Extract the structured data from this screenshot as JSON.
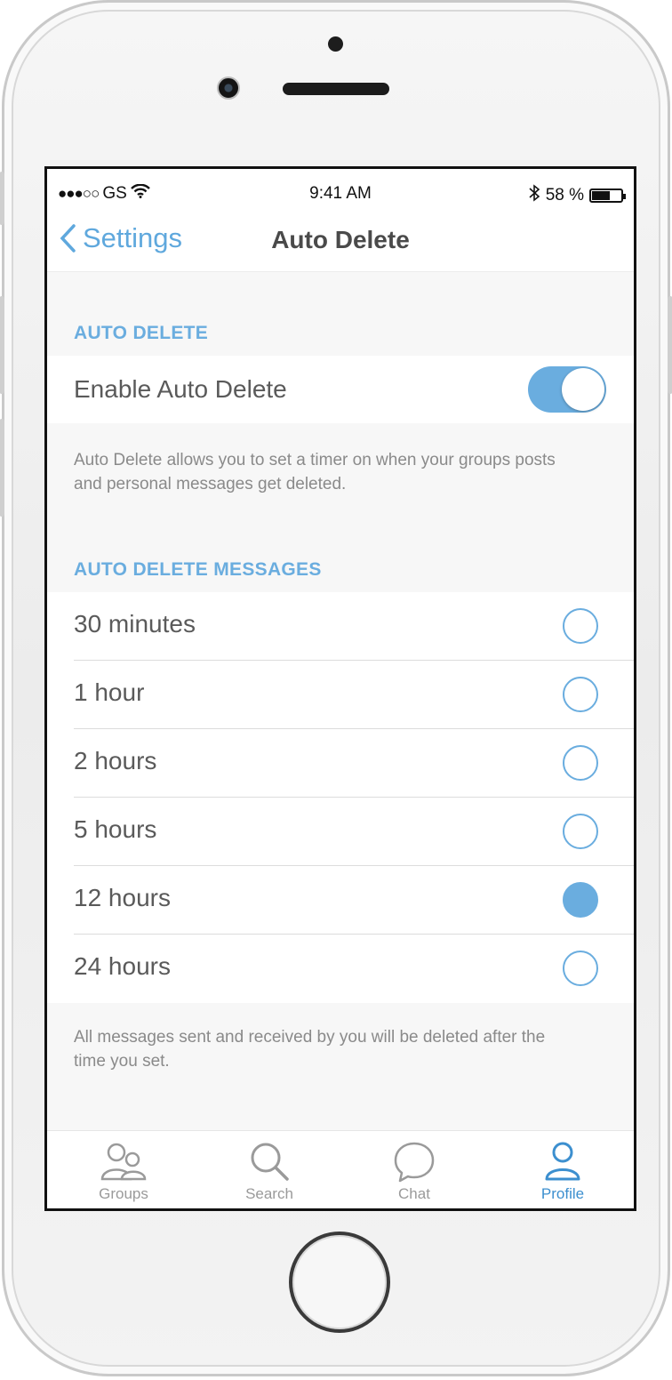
{
  "status_bar": {
    "signal": "●●●○○",
    "carrier": "GS",
    "time": "9:41 AM",
    "battery_percent": "58 %",
    "battery_level": 0.58
  },
  "nav": {
    "back_label": "Settings",
    "title": "Auto Delete"
  },
  "auto_delete_section": {
    "header": "AUTO DELETE",
    "toggle_label": "Enable Auto Delete",
    "toggle_on": true,
    "footnote": "Auto Delete allows you to set a timer on when your groups posts and personal messages get deleted."
  },
  "messages_section": {
    "header": "AUTO DELETE MESSAGES",
    "options": [
      {
        "label": "30 minutes",
        "selected": false
      },
      {
        "label": "1 hour",
        "selected": false
      },
      {
        "label": "2 hours",
        "selected": false
      },
      {
        "label": "5 hours",
        "selected": false
      },
      {
        "label": "12 hours",
        "selected": true
      },
      {
        "label": "24 hours",
        "selected": false
      }
    ],
    "footnote": "All messages sent and received by you will be deleted after the time you set."
  },
  "tab_bar": {
    "tabs": [
      {
        "label": "Groups",
        "icon": "groups-icon",
        "active": false
      },
      {
        "label": "Search",
        "icon": "search-icon",
        "active": false
      },
      {
        "label": "Chat",
        "icon": "chat-icon",
        "active": false
      },
      {
        "label": "Profile",
        "icon": "profile-icon",
        "active": true
      }
    ]
  },
  "colors": {
    "accent": "#6aaddf",
    "active_tab": "#3c8fcf",
    "inactive_tab": "#9a9a9a"
  }
}
